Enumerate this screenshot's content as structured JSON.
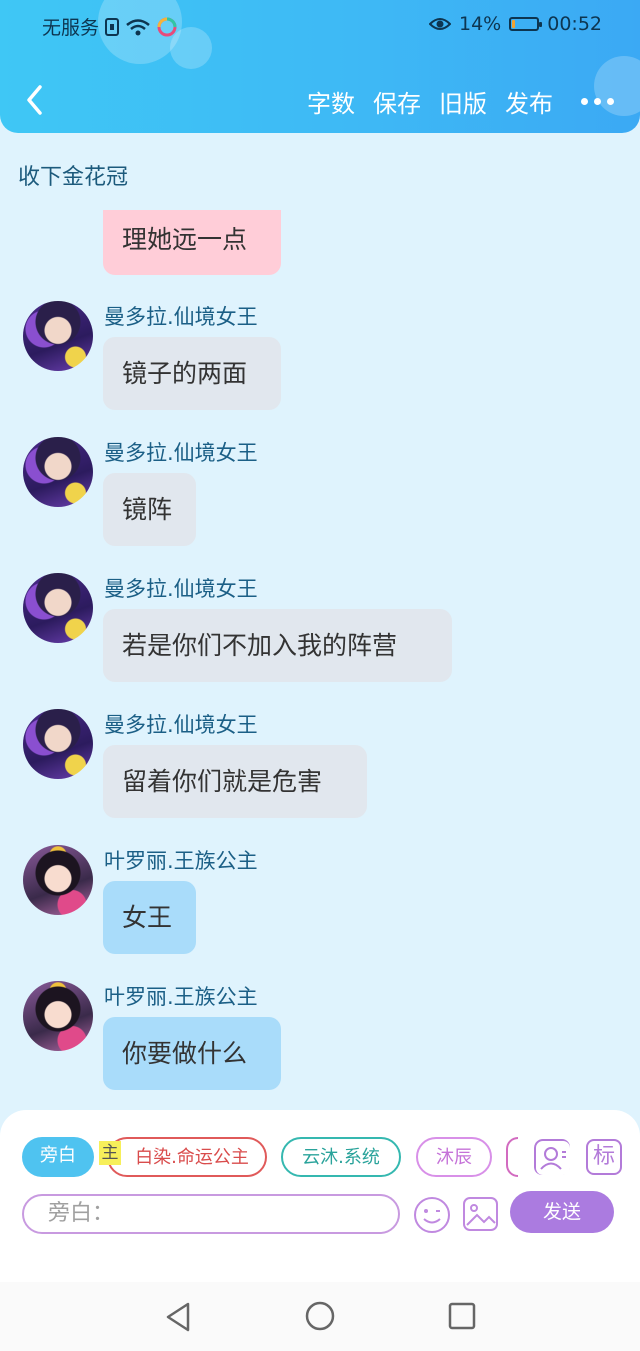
{
  "status_bar": {
    "carrier": "无服务",
    "battery_percent": "14%",
    "battery_level": 0.14,
    "time": "00:52"
  },
  "header": {
    "actions": [
      "字数",
      "保存",
      "旧版",
      "发布"
    ]
  },
  "story_title": "收下金花冠",
  "messages": [
    {
      "speaker": "",
      "text": "理她远一点",
      "style": "pink",
      "avatar": "partial-avatar"
    },
    {
      "speaker": "曼多拉.仙境女王",
      "text": "镜子的两面",
      "style": "gray",
      "avatar": "queen-avatar"
    },
    {
      "speaker": "曼多拉.仙境女王",
      "text": "镜阵",
      "style": "gray",
      "avatar": "queen-avatar"
    },
    {
      "speaker": "曼多拉.仙境女王",
      "text": "若是你们不加入我的阵营",
      "style": "gray",
      "avatar": "queen-avatar"
    },
    {
      "speaker": "曼多拉.仙境女王",
      "text": "留着你们就是危害",
      "style": "gray",
      "avatar": "queen-avatar"
    },
    {
      "speaker": "叶罗丽.王族公主",
      "text": "女王",
      "style": "blue",
      "avatar": "princess-avatar"
    },
    {
      "speaker": "叶罗丽.王族公主",
      "text": "你要做什么",
      "style": "blue",
      "avatar": "princess-avatar"
    }
  ],
  "input": {
    "roles": [
      {
        "label": "旁白",
        "state": "selected"
      },
      {
        "label": "白染.命运公主",
        "state": "outline-red",
        "tag": "主"
      },
      {
        "label": "云沐.系统",
        "state": "outline-teal"
      },
      {
        "label": "沐辰",
        "state": "outline-pink"
      }
    ],
    "mark_label": "标",
    "placeholder": "旁白：",
    "send_label": "发送"
  },
  "colors": {
    "header_gradient_start": "#3fc7f5",
    "header_gradient_end": "#3ba9f4",
    "chat_background": "#dff3fd",
    "send_button": "#ab7be0"
  }
}
